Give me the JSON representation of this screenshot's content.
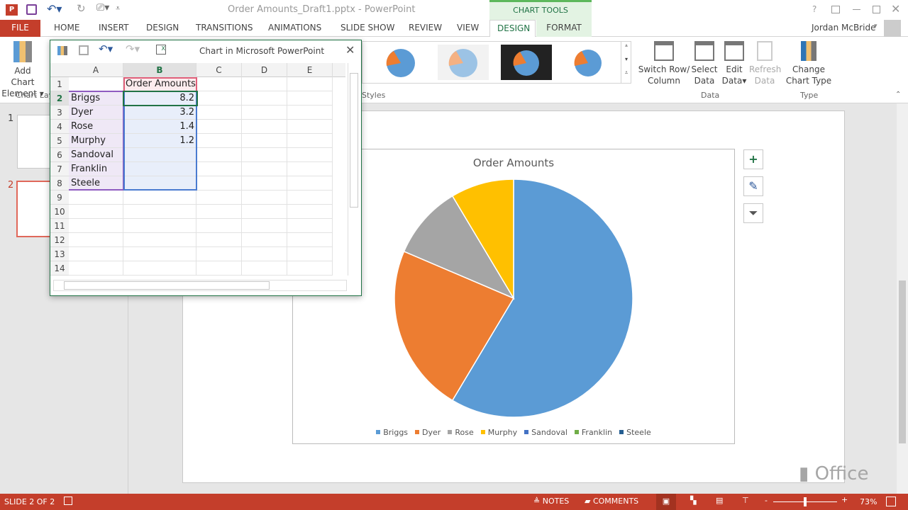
{
  "window": {
    "title": "Order Amounts_Draft1.pptx - PowerPoint",
    "context_tab": "CHART TOOLS",
    "user": "Jordan McBride",
    "help": "?"
  },
  "tabs": [
    "FILE",
    "HOME",
    "INSERT",
    "DESIGN",
    "TRANSITIONS",
    "ANIMATIONS",
    "SLIDE SHOW",
    "REVIEW",
    "VIEW",
    "DESIGN",
    "FORMAT"
  ],
  "ribbon": {
    "add_chart_element": [
      "Add Chart",
      "Element"
    ],
    "chart_layouts_group": "Chart Lay",
    "chart_styles_group": "Styles",
    "data_group": "Data",
    "type_group": "Type",
    "switch_row_col": [
      "Switch Row/",
      "Column"
    ],
    "select_data": [
      "Select",
      "Data"
    ],
    "edit_data": [
      "Edit",
      "Data"
    ],
    "refresh_data": [
      "Refresh",
      "Data"
    ],
    "change_chart_type": [
      "Change",
      "Chart Type"
    ]
  },
  "excel": {
    "title": "Chart in Microsoft PowerPoint",
    "columns": [
      "A",
      "B",
      "C",
      "D",
      "E"
    ],
    "rows": [
      {
        "n": "1",
        "a": "",
        "b": "Order Amounts"
      },
      {
        "n": "2",
        "a": "Briggs",
        "b": "8.2"
      },
      {
        "n": "3",
        "a": "Dyer",
        "b": "3.2"
      },
      {
        "n": "4",
        "a": "Rose",
        "b": "1.4"
      },
      {
        "n": "5",
        "a": "Murphy",
        "b": "1.2"
      },
      {
        "n": "6",
        "a": "Sandoval",
        "b": ""
      },
      {
        "n": "7",
        "a": "Franklin",
        "b": ""
      },
      {
        "n": "8",
        "a": "Steele",
        "b": ""
      },
      {
        "n": "9",
        "a": "",
        "b": ""
      },
      {
        "n": "10",
        "a": "",
        "b": ""
      },
      {
        "n": "11",
        "a": "",
        "b": ""
      },
      {
        "n": "12",
        "a": "",
        "b": ""
      },
      {
        "n": "13",
        "a": "",
        "b": ""
      },
      {
        "n": "14",
        "a": "",
        "b": ""
      }
    ]
  },
  "thumbnails": [
    "1",
    "2"
  ],
  "chart_data": {
    "type": "pie",
    "title": "Order Amounts",
    "categories": [
      "Briggs",
      "Dyer",
      "Rose",
      "Murphy",
      "Sandoval",
      "Franklin",
      "Steele"
    ],
    "values": [
      8.2,
      3.2,
      1.4,
      1.2,
      null,
      null,
      null
    ],
    "colors": [
      "#5b9bd5",
      "#ed7d31",
      "#a5a5a5",
      "#ffc000",
      "#4472c4",
      "#70ad47",
      "#255e91"
    ],
    "legend": "bottom"
  },
  "status": {
    "slide": "SLIDE 2 OF 2",
    "notes": "NOTES",
    "comments": "COMMENTS",
    "zoom": "73%",
    "zoom_level": 73
  },
  "watermark": "Office"
}
